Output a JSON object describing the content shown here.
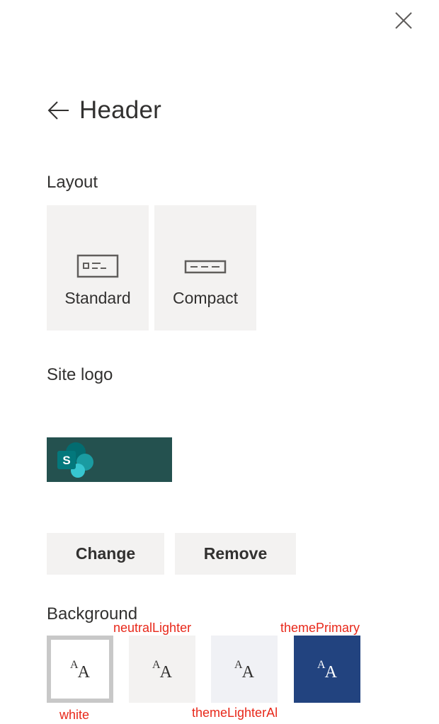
{
  "panel": {
    "title": "Header",
    "sections": {
      "layout_label": "Layout",
      "site_logo_label": "Site logo",
      "background_label": "Background"
    }
  },
  "layout_options": [
    {
      "label": "Standard",
      "icon": "header-standard-icon"
    },
    {
      "label": "Compact",
      "icon": "header-compact-icon"
    }
  ],
  "logo": {
    "icon": "sharepoint-logo-icon",
    "letter": "S",
    "background_color": "#24514f"
  },
  "buttons": {
    "change_label": "Change",
    "remove_label": "Remove"
  },
  "background_swatches": [
    {
      "text": "AA",
      "color": "#ffffff",
      "selected": true,
      "annotation": "white"
    },
    {
      "text": "AA",
      "color": "#f3f2f1",
      "selected": false,
      "annotation": "neutralLighter"
    },
    {
      "text": "AA",
      "color": "#f0f1f5",
      "selected": false,
      "annotation": "themeLighterAl"
    },
    {
      "text": "AA",
      "color": "#22437f",
      "selected": false,
      "annotation": "themePrimary"
    }
  ],
  "annotation_color": "#e8281a"
}
